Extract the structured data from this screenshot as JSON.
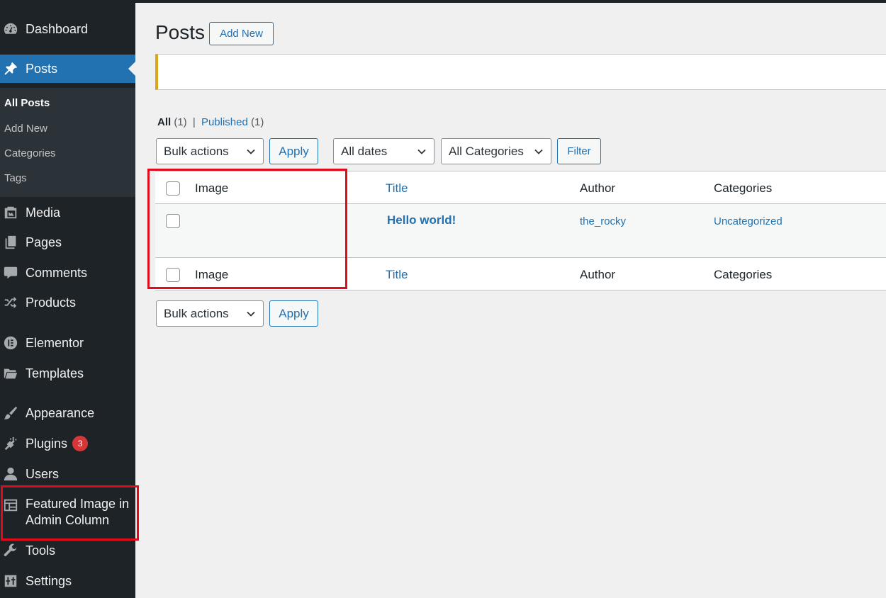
{
  "sidebar": {
    "items": [
      {
        "label": "Dashboard",
        "icon": "dashboard-icon"
      },
      {
        "label": "Posts",
        "icon": "pin-icon"
      },
      {
        "label": "Media",
        "icon": "media-icon"
      },
      {
        "label": "Pages",
        "icon": "pages-icon"
      },
      {
        "label": "Comments",
        "icon": "comment-icon"
      },
      {
        "label": "Products",
        "icon": "shuffle-icon"
      },
      {
        "label": "Elementor",
        "icon": "elementor-icon"
      },
      {
        "label": "Templates",
        "icon": "folder-icon"
      },
      {
        "label": "Appearance",
        "icon": "brush-icon"
      },
      {
        "label": "Plugins",
        "icon": "plug-icon",
        "badge": "3"
      },
      {
        "label": "Users",
        "icon": "user-icon"
      },
      {
        "label": "Featured Image in Admin Column",
        "icon": "table-icon"
      },
      {
        "label": "Tools",
        "icon": "wrench-icon"
      },
      {
        "label": "Settings",
        "icon": "settings-icon"
      }
    ],
    "posts_submenu": [
      "All Posts",
      "Add New",
      "Categories",
      "Tags"
    ]
  },
  "header": {
    "title": "Posts",
    "add_new": "Add New"
  },
  "views": {
    "all_label": "All",
    "all_count": "(1)",
    "separator": "|",
    "published_label": "Published",
    "published_count": "(1)"
  },
  "filters": {
    "bulk_actions": "Bulk actions",
    "apply": "Apply",
    "dates": "All dates",
    "categories": "All Categories",
    "filter": "Filter"
  },
  "table": {
    "columns": [
      "Image",
      "Title",
      "Author",
      "Categories"
    ],
    "rows": [
      {
        "image": "",
        "title": "Hello world!",
        "author": "the_rocky",
        "categories": "Uncategorized"
      }
    ]
  },
  "colors": {
    "sidebar_bg": "#1d2327",
    "accent": "#2271b1",
    "highlight": "#e00b1c",
    "notice_border": "#dba617",
    "badge": "#d63638"
  }
}
